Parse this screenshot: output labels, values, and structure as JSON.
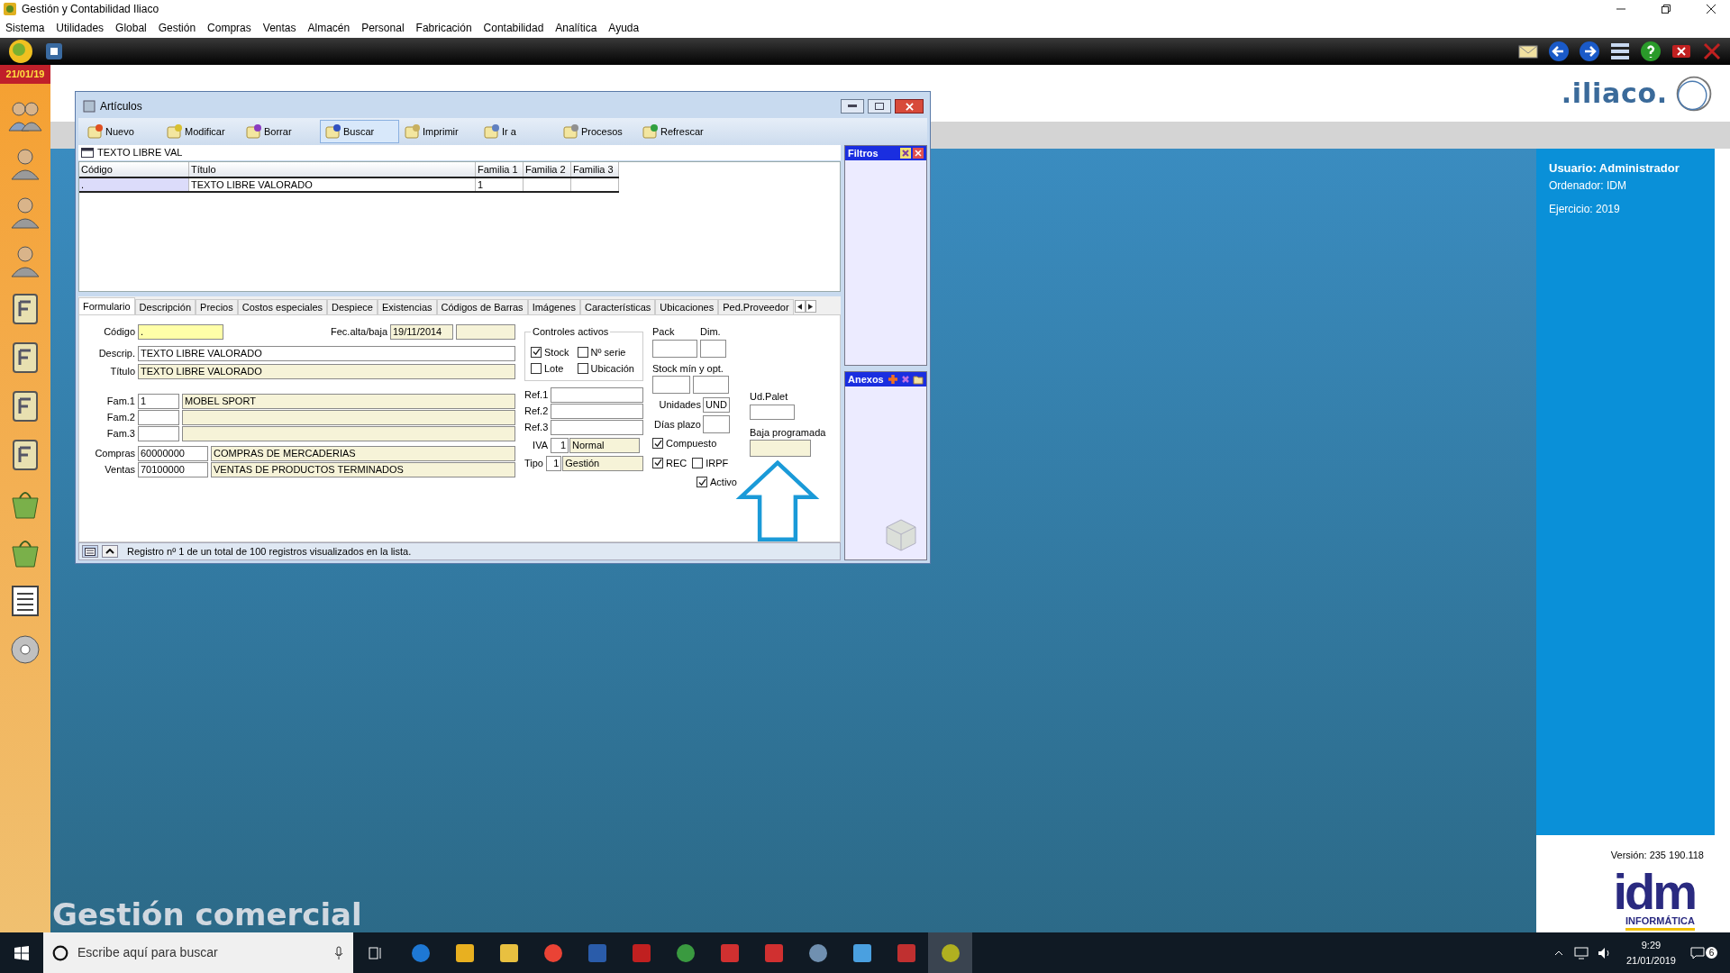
{
  "app": {
    "title": "Gestión y Contabilidad Iliaco"
  },
  "menu": [
    "Sistema",
    "Utilidades",
    "Global",
    "Gestión",
    "Compras",
    "Ventas",
    "Almacén",
    "Personal",
    "Fabricación",
    "Contabilidad",
    "Analítica",
    "Ayuda"
  ],
  "date": "21/01/19",
  "window": {
    "title": "Artículos"
  },
  "toolbar": [
    {
      "label": "Nuevo",
      "selected": false
    },
    {
      "label": "Modificar",
      "selected": false
    },
    {
      "label": "Borrar",
      "selected": false
    },
    {
      "label": "Buscar",
      "selected": true
    },
    {
      "label": "Imprimir",
      "selected": false
    },
    {
      "label": "Ir a",
      "selected": false
    },
    {
      "label": "Procesos",
      "selected": false
    },
    {
      "label": "Refrescar",
      "selected": false
    }
  ],
  "search": {
    "value": "TEXTO LIBRE VAL"
  },
  "table": {
    "columns": [
      "Código",
      "Título",
      "Familia 1",
      "Familia 2",
      "Familia 3"
    ],
    "rows": [
      {
        "cells": [
          ".",
          "TEXTO LIBRE VALORADO",
          "1"
        ],
        "selected": true
      }
    ]
  },
  "tabs": [
    {
      "label": "Formulario",
      "selected": true
    },
    {
      "label": "Descripción",
      "selected": false
    },
    {
      "label": "Precios",
      "selected": false
    },
    {
      "label": "Costos especiales",
      "selected": false
    },
    {
      "label": "Despiece",
      "selected": false
    },
    {
      "label": "Existencias",
      "selected": false
    },
    {
      "label": "Códigos de Barras",
      "selected": false
    },
    {
      "label": "Imágenes",
      "selected": false
    },
    {
      "label": "Características",
      "selected": false
    },
    {
      "label": "Ubicaciones",
      "selected": false
    },
    {
      "label": "Ped.Proveedor",
      "selected": false
    }
  ],
  "form": {
    "codigo": {
      "label": "Código",
      "value": "."
    },
    "fecha": {
      "label": "Fec.alta/baja",
      "value": "19/11/2014"
    },
    "descrip": {
      "label": "Descrip.",
      "value": "TEXTO LIBRE VALORADO"
    },
    "titulo": {
      "label": "Título",
      "value": "TEXTO LIBRE VALORADO"
    },
    "families": [
      {
        "label": "Fam.1",
        "code": "1",
        "name": "MOBEL SPORT"
      },
      {
        "label": "Fam.2"
      },
      {
        "label": "Fam.3"
      }
    ],
    "accounts": [
      {
        "label": "Compras",
        "code": "60000000",
        "name": "COMPRAS DE MERCADERIAS"
      },
      {
        "label": "Ventas",
        "code": "70100000",
        "name": "VENTAS DE PRODUCTOS TERMINADOS"
      }
    ],
    "controls": {
      "title": "Controles activos",
      "items": [
        {
          "label": "Stock",
          "checked": true
        },
        {
          "label": "Nº serie",
          "checked": false
        },
        {
          "label": "Lote",
          "checked": false
        },
        {
          "label": "Ubicación",
          "checked": false
        }
      ]
    },
    "refs": [
      "Ref.1",
      "Ref.2",
      "Ref.3"
    ],
    "iva": {
      "label": "IVA",
      "code": "1",
      "name": "Normal"
    },
    "tipo": {
      "label": "Tipo",
      "code": "1",
      "name": "Gestión"
    },
    "pack": "Pack",
    "dim": "Dim.",
    "stock": "Stock mín y opt.",
    "unidades": {
      "label": "Unidades",
      "value": "UND"
    },
    "dias": "Días plazo",
    "flags": [
      {
        "label": "Compuesto",
        "checked": true
      },
      {
        "label": "REC",
        "checked": true
      },
      {
        "label": "IRPF",
        "checked": false
      },
      {
        "label": "Activo",
        "checked": true
      }
    ],
    "ud_palet": "Ud.Palet",
    "baja": "Baja programada"
  },
  "status": "Registro nº 1 de un total de 100 registros visualizados en la lista.",
  "filters": {
    "title": "Filtros"
  },
  "attachments": {
    "title": "Anexos"
  },
  "brand": {
    "iliaco": ".iliaco.",
    "idm": "idm",
    "idm_sub": "INFORMÁTICA"
  },
  "info": {
    "user": "Usuario: Administrador",
    "computer": "Ordenador: IDM",
    "year": "Ejercicio: 2019",
    "version": "Versión: 235 190.118"
  },
  "module_title": "Gestión comercial",
  "taskbar": {
    "search_placeholder": "Escribe aquí para buscar",
    "time": "9:29",
    "date": "21/01/2019",
    "notifications": "6"
  }
}
